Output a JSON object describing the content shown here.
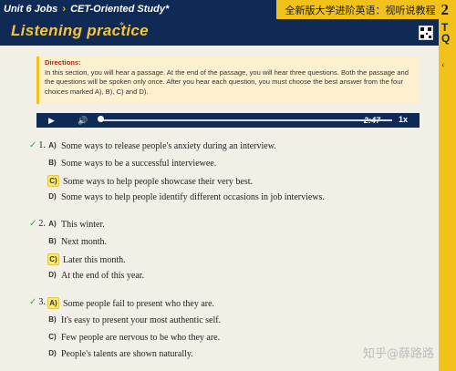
{
  "breadcrumb": {
    "part1": "Unit 6 Jobs",
    "sep": "›",
    "part2": "CET-Oriented Study",
    "star": "*"
  },
  "course": {
    "title": "全新版大学进阶英语：视听说教程",
    "volume": "2"
  },
  "section": {
    "title": "Listening practice",
    "star": "*"
  },
  "side": {
    "top_glyph": "T Q"
  },
  "directions": {
    "label": "Directions:",
    "text": "In this section, you will hear a passage. At the end of the passage, you will hear three questions. Both the passage and the questions will be spoken only once. After you hear each question, you must choose the best answer from the four choices marked A), B), C) and D)."
  },
  "audio": {
    "time": "-2:47",
    "speed": "1x"
  },
  "questions": [
    {
      "number": "1.",
      "options": [
        {
          "letter": "A)",
          "text": "Some ways to release people's anxiety during an interview.",
          "selected": false
        },
        {
          "letter": "B)",
          "text": "Some ways to be a successful interviewee.",
          "selected": false
        },
        {
          "letter": "C)",
          "text": "Some ways to help people showcase their very best.",
          "selected": true
        },
        {
          "letter": "D)",
          "text": "Some ways to help people identify different occasions in job interviews.",
          "selected": false
        }
      ]
    },
    {
      "number": "2.",
      "options": [
        {
          "letter": "A)",
          "text": "This winter.",
          "selected": false
        },
        {
          "letter": "B)",
          "text": "Next month.",
          "selected": false
        },
        {
          "letter": "C)",
          "text": "Later this month.",
          "selected": true
        },
        {
          "letter": "D)",
          "text": "At the end of this year.",
          "selected": false
        }
      ]
    },
    {
      "number": "3.",
      "options": [
        {
          "letter": "A)",
          "text": "Some people fail to present who they are.",
          "selected": true
        },
        {
          "letter": "B)",
          "text": "It's easy to present your most authentic self.",
          "selected": false
        },
        {
          "letter": "C)",
          "text": "Few people are nervous to be who they are.",
          "selected": false
        },
        {
          "letter": "D)",
          "text": "People's talents are shown naturally.",
          "selected": false
        }
      ]
    }
  ],
  "watermark": {
    "text": "知乎@薛路路"
  },
  "colors": {
    "navy": "#0f2a55",
    "gold": "#f2c21a",
    "check": "#3ea748"
  }
}
